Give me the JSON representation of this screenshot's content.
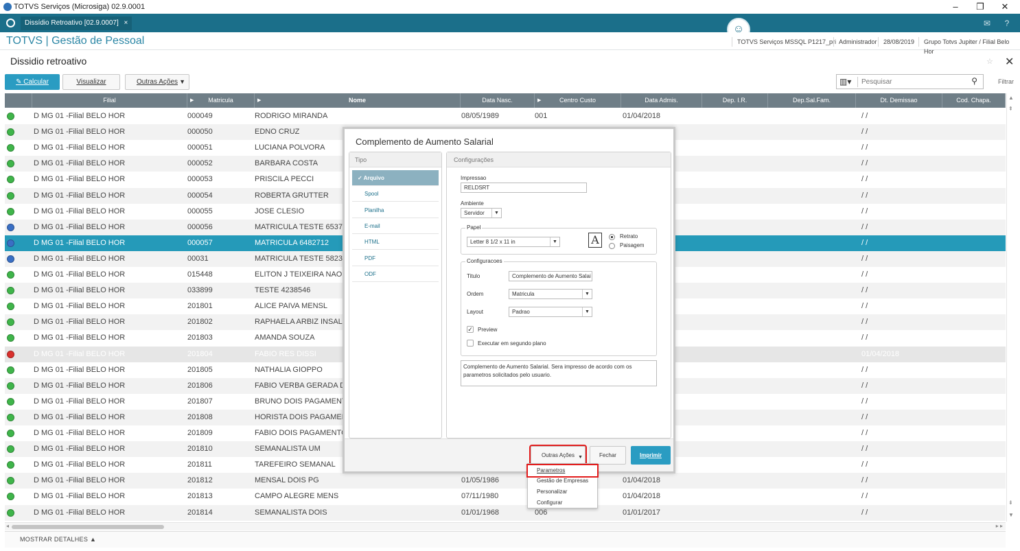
{
  "window": {
    "title": "TOTVS Serviços (Microsiga) 02.9.0001",
    "minimize": "–",
    "restore": "❐",
    "close": "✕"
  },
  "tab": {
    "label": "Dissídio Retroativo [02.9.0007]",
    "close": "×"
  },
  "header": {
    "app_title": "TOTVS | Gestão de Pessoal",
    "server": "TOTVS Serviços MSSQL P1217_pri",
    "user": "Administrador",
    "date": "28/08/2019",
    "branch": "Grupo Totvs Jupiter / Filial Belo Hor"
  },
  "page": {
    "title": "Dissidio retroativo",
    "close": "✕",
    "star": "☆"
  },
  "toolbar": {
    "calcular": "Calcular",
    "visualizar": "Visualizar",
    "outras_acoes": "Outras Ações",
    "search_placeholder": "Pesquisar",
    "filtrar": "Filtrar"
  },
  "grid": {
    "columns": [
      "Filial",
      "Matricula",
      "Nome",
      "Data Nasc.",
      "Centro Custo",
      "Data Admis.",
      "Dep. I.R.",
      "Dep.Sal.Fam.",
      "Dt. Demissao",
      "Cod. Chapa."
    ],
    "rows": [
      {
        "status": "green",
        "filial": "D MG 01 -Filial BELO HOR",
        "mat": "000049",
        "nome": "RODRIGO MIRANDA",
        "nasc": "08/05/1989",
        "cc": "001",
        "admis": "01/04/2018",
        "dem": "/ /"
      },
      {
        "status": "green",
        "filial": "D MG 01 -Filial BELO HOR",
        "mat": "000050",
        "nome": "EDNO CRUZ",
        "nasc": "",
        "cc": "",
        "admis": "",
        "dem": "/ /"
      },
      {
        "status": "green",
        "filial": "D MG 01 -Filial BELO HOR",
        "mat": "000051",
        "nome": "LUCIANA POLVORA",
        "nasc": "",
        "cc": "",
        "admis": "",
        "dem": "/ /"
      },
      {
        "status": "green",
        "filial": "D MG 01 -Filial BELO HOR",
        "mat": "000052",
        "nome": "BARBARA COSTA",
        "nasc": "",
        "cc": "",
        "admis": "",
        "dem": "/ /"
      },
      {
        "status": "green",
        "filial": "D MG 01 -Filial BELO HOR",
        "mat": "000053",
        "nome": "PRISCILA PECCI",
        "nasc": "",
        "cc": "",
        "admis": "",
        "dem": "/ /"
      },
      {
        "status": "green",
        "filial": "D MG 01 -Filial BELO HOR",
        "mat": "000054",
        "nome": "ROBERTA GRUTTER",
        "nasc": "",
        "cc": "",
        "admis": "",
        "dem": "/ /"
      },
      {
        "status": "green",
        "filial": "D MG 01 -Filial BELO HOR",
        "mat": "000055",
        "nome": "JOSE CLESIO",
        "nasc": "",
        "cc": "",
        "admis": "",
        "dem": "/ /"
      },
      {
        "status": "blue",
        "filial": "D MG 01 -Filial BELO HOR",
        "mat": "000056",
        "nome": "MATRICULA TESTE 6537",
        "nasc": "",
        "cc": "",
        "admis": "",
        "dem": "/ /"
      },
      {
        "status": "blue",
        "filial": "D MG 01 -Filial BELO HOR",
        "mat": "000057",
        "nome": "MATRICULA 6482712",
        "nasc": "",
        "cc": "",
        "admis": "",
        "dem": "/ /"
      },
      {
        "status": "blue",
        "filial": "D MG 01 -Filial BELO HOR",
        "mat": "00031",
        "nome": "MATRICULA TESTE 5823",
        "nasc": "",
        "cc": "",
        "admis": "",
        "dem": "/ /"
      },
      {
        "status": "green",
        "filial": "D MG 01 -Filial BELO HOR",
        "mat": "015448",
        "nome": "ELITON J TEIXEIRA NAO U",
        "nasc": "",
        "cc": "",
        "admis": "",
        "dem": "/ /"
      },
      {
        "status": "green",
        "filial": "D MG 01 -Filial BELO HOR",
        "mat": "033899",
        "nome": "TESTE 4238546",
        "nasc": "",
        "cc": "",
        "admis": "",
        "dem": "/ /"
      },
      {
        "status": "green",
        "filial": "D MG 01 -Filial BELO HOR",
        "mat": "201801",
        "nome": "ALICE PAIVA MENSL",
        "nasc": "",
        "cc": "",
        "admis": "",
        "dem": "/ /"
      },
      {
        "status": "green",
        "filial": "D MG 01 -Filial BELO HOR",
        "mat": "201802",
        "nome": "RAPHAELA ARBIZ INSAL",
        "nasc": "",
        "cc": "",
        "admis": "",
        "dem": "/ /"
      },
      {
        "status": "green",
        "filial": "D MG 01 -Filial BELO HOR",
        "mat": "201803",
        "nome": "AMANDA SOUZA",
        "nasc": "",
        "cc": "",
        "admis": "",
        "dem": "/ /"
      },
      {
        "status": "red",
        "filial": "D MG 01 -Filial BELO HOR",
        "mat": "201804",
        "nome": "FABIO RES DISSI",
        "nasc": "",
        "cc": "",
        "admis": "",
        "dem": "01/04/2018"
      },
      {
        "status": "green",
        "filial": "D MG 01 -Filial BELO HOR",
        "mat": "201805",
        "nome": "NATHALIA GIOPPO",
        "nasc": "",
        "cc": "",
        "admis": "",
        "dem": "/ /"
      },
      {
        "status": "green",
        "filial": "D MG 01 -Filial BELO HOR",
        "mat": "201806",
        "nome": "FABIO VERBA GERADA D",
        "nasc": "",
        "cc": "",
        "admis": "",
        "dem": "/ /"
      },
      {
        "status": "green",
        "filial": "D MG 01 -Filial BELO HOR",
        "mat": "201807",
        "nome": "BRUNO DOIS PAGAMENT",
        "nasc": "",
        "cc": "",
        "admis": "",
        "dem": "/ /"
      },
      {
        "status": "green",
        "filial": "D MG 01 -Filial BELO HOR",
        "mat": "201808",
        "nome": "HORISTA DOIS PAGAMEN",
        "nasc": "",
        "cc": "",
        "admis": "",
        "dem": "/ /"
      },
      {
        "status": "green",
        "filial": "D MG 01 -Filial BELO HOR",
        "mat": "201809",
        "nome": "FABIO DOIS PAGAMENTO",
        "nasc": "",
        "cc": "",
        "admis": "",
        "dem": "/ /"
      },
      {
        "status": "green",
        "filial": "D MG 01 -Filial BELO HOR",
        "mat": "201810",
        "nome": "SEMANALISTA UM",
        "nasc": "",
        "cc": "",
        "admis": "",
        "dem": "/ /"
      },
      {
        "status": "green",
        "filial": "D MG 01 -Filial BELO HOR",
        "mat": "201811",
        "nome": "TAREFEIRO SEMANAL",
        "nasc": "",
        "cc": "",
        "admis": "",
        "dem": "/ /"
      },
      {
        "status": "green",
        "filial": "D MG 01 -Filial BELO HOR",
        "mat": "201812",
        "nome": "MENSAL DOIS PG",
        "nasc": "01/05/1986",
        "cc": "",
        "admis": "01/04/2018",
        "dem": "/ /"
      },
      {
        "status": "green",
        "filial": "D MG 01 -Filial BELO HOR",
        "mat": "201813",
        "nome": "CAMPO ALEGRE MENS",
        "nasc": "07/11/1980",
        "cc": "",
        "admis": "01/04/2018",
        "dem": "/ /"
      },
      {
        "status": "green",
        "filial": "D MG 01 -Filial BELO HOR",
        "mat": "201814",
        "nome": "SEMANALISTA DOIS",
        "nasc": "01/01/1968",
        "cc": "006",
        "admis": "01/01/2017",
        "dem": "/ /"
      }
    ],
    "selected_index": 8,
    "disabled_index": 15
  },
  "details": "MOSTRAR DETALHES ▲",
  "dialog": {
    "title": "Complemento de Aumento Salarial",
    "tipo_header": "Tipo",
    "tipo_items": [
      "Arquivo",
      "Spool",
      "Planilha",
      "E-mail",
      "HTML",
      "PDF",
      "ODF"
    ],
    "tipo_selected": "Arquivo",
    "conf_header": "Configurações",
    "impressao_label": "Impressao",
    "impressao_value": "RELDSRT",
    "ambiente_label": "Ambiente",
    "ambiente_value": "Servidor",
    "papel_legend": "Papel",
    "papel_value": "Letter 8 1/2 x 11 in",
    "retrato": "Retrato",
    "paisagem": "Paisagem",
    "configuracoes_legend": "Configuracoes",
    "titulo_label": "Titulo",
    "titulo_value": "Complemento de Aumento Salai",
    "ordem_label": "Ordem",
    "ordem_value": "Matricula",
    "layout_label": "Layout",
    "layout_value": "Padrao",
    "preview": "Preview",
    "segundo_plano": "Executar em segundo plano",
    "description": "Complemento de Aumento Salarial. Sera impresso de acordo com os parametros solicitados pelo usuario.",
    "btn_outras": "Outras Ações",
    "btn_fechar": "Fechar",
    "btn_imprimir": "Imprimir"
  },
  "menu": [
    "Parametros",
    "Gestão de Empresas",
    "Personalizar",
    "Configurar"
  ],
  "colors": {
    "teal": "#1b6f8a",
    "accent": "#2a9cc2",
    "selected_row": "#259ab9",
    "green": "#3fb54a",
    "blue": "#3a6fc4",
    "red": "#d9302c"
  }
}
